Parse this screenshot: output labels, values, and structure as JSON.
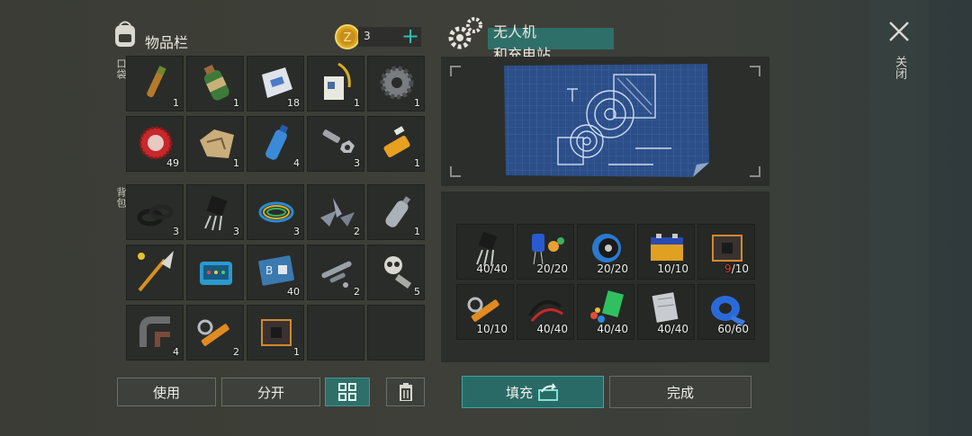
{
  "inventory": {
    "title": "物品栏",
    "coins": "3",
    "pocket_label": "口袋",
    "backpack_label": "背包",
    "pocket_items": [
      {
        "icon": "vial-icon",
        "count": "1"
      },
      {
        "icon": "canteen-icon",
        "count": "1"
      },
      {
        "icon": "salt-bag-icon",
        "count": "18"
      },
      {
        "icon": "id-badge-icon",
        "count": "1"
      },
      {
        "icon": "gear-icon",
        "count": "1"
      },
      {
        "icon": "bottle-cap-icon",
        "count": "49"
      },
      {
        "icon": "map-scrap-icon",
        "count": "1"
      },
      {
        "icon": "water-bottle-icon",
        "count": "4"
      },
      {
        "icon": "bolt-nut-icon",
        "count": "3"
      },
      {
        "icon": "glue-tube-icon",
        "count": "1"
      }
    ],
    "backpack_items": [
      {
        "icon": "rubber-rings-icon",
        "count": "3"
      },
      {
        "icon": "transistor-icon",
        "count": "3"
      },
      {
        "icon": "wire-coil-icon",
        "count": "3"
      },
      {
        "icon": "metal-shards-icon",
        "count": "2"
      },
      {
        "icon": "plastic-bottle-icon",
        "count": "1"
      },
      {
        "icon": "spear-icon",
        "count": ""
      },
      {
        "icon": "tackle-box-icon",
        "count": ""
      },
      {
        "icon": "blueprint-card-icon",
        "count": "40"
      },
      {
        "icon": "pipe-parts-icon",
        "count": "2"
      },
      {
        "icon": "skull-parts-icon",
        "count": "5"
      },
      {
        "icon": "pipe-elbow-icon",
        "count": "4"
      },
      {
        "icon": "hydraulic-icon",
        "count": "2"
      },
      {
        "icon": "circuit-board-icon",
        "count": "1"
      },
      {
        "icon": "empty-slot",
        "count": ""
      },
      {
        "icon": "empty-slot",
        "count": ""
      }
    ],
    "buttons": {
      "use": "使用",
      "split": "分开"
    }
  },
  "craft": {
    "title_line1": "无人机",
    "title_line2": "和充电站",
    "requirements": [
      {
        "icon": "transistor-icon",
        "count": "40/40"
      },
      {
        "icon": "capacitor-icon",
        "count": "20/20"
      },
      {
        "icon": "wire-spool-icon",
        "count": "20/20"
      },
      {
        "icon": "battery-icon",
        "count": "10/10"
      },
      {
        "icon": "circuit-board-icon",
        "count": "9/10",
        "short": "9",
        "full": "/10"
      },
      {
        "icon": "hydraulic-icon",
        "count": "10/10"
      },
      {
        "icon": "cables-icon",
        "count": "40/40"
      },
      {
        "icon": "plastic-parts-icon",
        "count": "40/40"
      },
      {
        "icon": "metal-scrap-icon",
        "count": "40/40"
      },
      {
        "icon": "tape-icon",
        "count": "60/60"
      }
    ],
    "buttons": {
      "fill": "填充",
      "done": "完成"
    }
  },
  "close": {
    "label": "关闭"
  },
  "colors": {
    "accent": "#2f6f69",
    "shortage": "#e23b2a"
  }
}
